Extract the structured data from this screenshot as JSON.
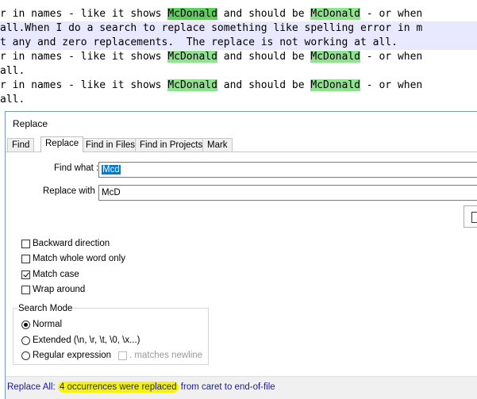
{
  "editor": {
    "lines": [
      {
        "pre": "r in names - like it shows ",
        "m1": "McDonald",
        "mid": " and should be ",
        "m2": "McDonald",
        "post": " - or when"
      },
      {
        "text": "all.When I do a search to replace something like spelling error in m"
      },
      {
        "text": "t any and zero replacements.  The replace is not working at all."
      },
      {
        "pre": "r in names - like it shows ",
        "m1": "McDonald",
        "mid": " and should be ",
        "m2": "McDonald",
        "post": " - or when"
      },
      {
        "text": "all."
      },
      {
        "pre": "r in names - like it shows ",
        "m1": "McDonald",
        "mid": " and should be ",
        "m2": "McDonald",
        "post": " - or when"
      },
      {
        "text": "all."
      }
    ]
  },
  "dialog": {
    "title": "Replace",
    "tabs": [
      "Find",
      "Replace",
      "Find in Files",
      "Find in Projects",
      "Mark"
    ],
    "active_tab": "Replace",
    "find_label": "Find what :",
    "find_value": "Mcd",
    "replace_label": "Replace with :",
    "replace_value": "McD",
    "options": {
      "backward": {
        "label": "Backward direction",
        "checked": false
      },
      "whole_word": {
        "label": "Match whole word only",
        "checked": false
      },
      "match_case": {
        "label": "Match case",
        "checked": true
      },
      "wrap_around": {
        "label": "Wrap around",
        "checked": false
      }
    },
    "search_mode": {
      "title": "Search Mode",
      "normal": "Normal",
      "extended": "Extended (\\n, \\r, \\t, \\0, \\x...)",
      "regex": "Regular expression",
      "dot_newline": ". matches newline",
      "selected": "normal"
    },
    "status": {
      "prefix": "Replace All: ",
      "highlight": "4 occurrences were replaced",
      "suffix": " from caret to end-of-file"
    }
  }
}
